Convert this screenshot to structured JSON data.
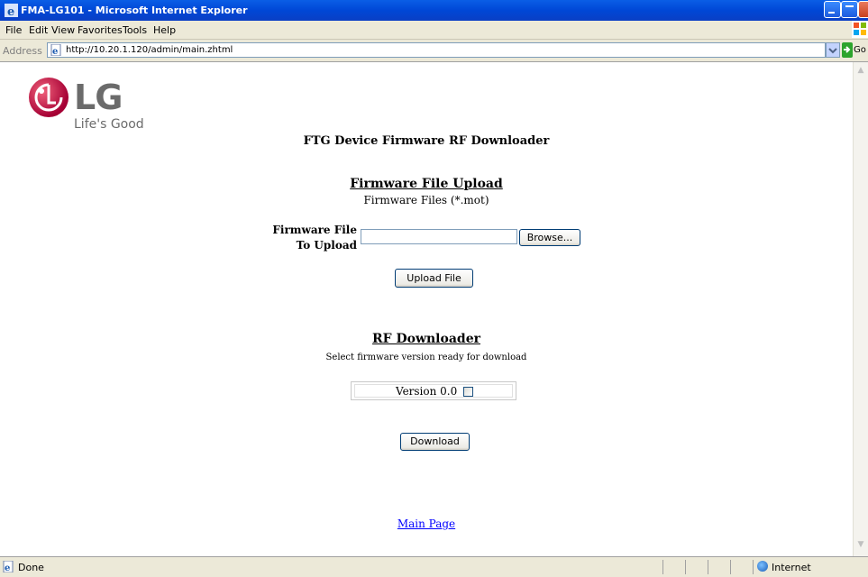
{
  "window": {
    "title": "FMA-LG101 - Microsoft Internet Explorer"
  },
  "menu": [
    "File",
    "Edit",
    "View",
    "Favorites",
    "Tools",
    "Help"
  ],
  "address": {
    "label": "Address",
    "url": "http://10.20.1.120/admin/main.zhtml",
    "go_label": "Go"
  },
  "logo": {
    "brand": "LG",
    "tagline": "Life's Good"
  },
  "page": {
    "heading": "FTG Device Firmware RF Downloader",
    "upload": {
      "title": "Firmware File Upload",
      "subtitle": "Firmware Files (*.mot)",
      "label_line1": "Firmware File",
      "label_line2": "To Upload",
      "browse_label": "Browse...",
      "upload_label": "Upload File"
    },
    "rf": {
      "title": "RF Downloader",
      "subtitle": "Select firmware version ready for download",
      "version_label": "Version  0.0",
      "version_checked": false,
      "download_label": "Download"
    },
    "main_link": "Main Page"
  },
  "status": {
    "text": "Done",
    "zone": "Internet"
  },
  "colors": {
    "title_bar": "#0047d6",
    "chrome": "#ece9d8",
    "link": "#0000ff",
    "lg_red": "#a50034"
  }
}
